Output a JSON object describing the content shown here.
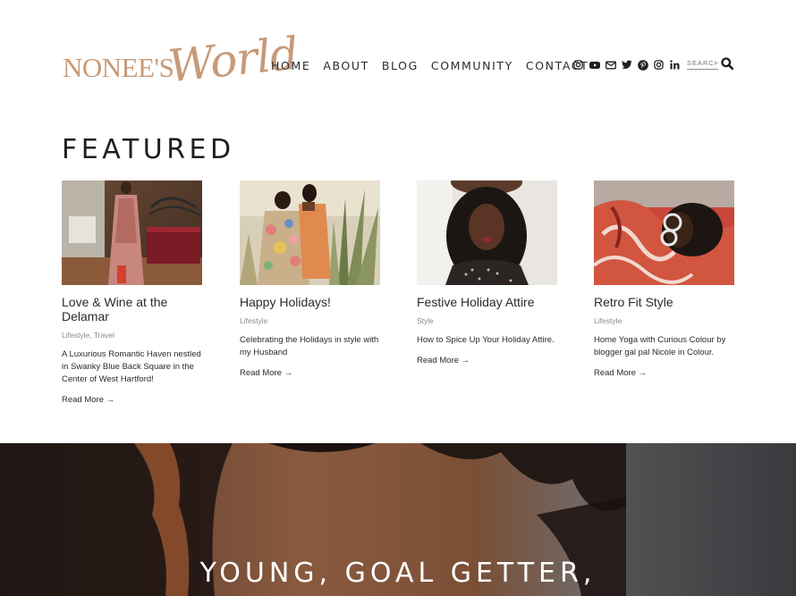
{
  "logo": {
    "main": "NONEE'S",
    "script": "World"
  },
  "nav": [
    "HOME",
    "ABOUT",
    "BLOG",
    "COMMUNITY",
    "CONTACT"
  ],
  "socials": [
    "instagram-icon",
    "youtube-icon",
    "mail-icon",
    "twitter-icon",
    "pinterest-icon",
    "instagram-icon",
    "linkedin-icon"
  ],
  "search": {
    "placeholder": "SEARCH"
  },
  "featured": {
    "heading": "FEATURED",
    "cards": [
      {
        "title": "Love & Wine at the Delamar",
        "category": "Lifestyle, Travel",
        "excerpt": "A Luxurious Romantic Haven nestled in Swanky Blue Back Square in the Center of West Hartford!",
        "more": "Read More →"
      },
      {
        "title": "Happy Holidays!",
        "category": "Lifestyle",
        "excerpt": "Celebrating the Holidays in style with my Husband",
        "more": "Read More →"
      },
      {
        "title": "Festive Holiday Attire",
        "category": "Style",
        "excerpt": "How to Spice Up Your Holiday Attire.",
        "more": "Read More →"
      },
      {
        "title": "Retro Fit Style",
        "category": "Lifestyle",
        "excerpt": "Home Yoga with Curious Colour by blogger gal pal Nicole in Colour.",
        "more": "Read More →"
      }
    ]
  },
  "hero": {
    "text": "YOUNG, GOAL GETTER,"
  },
  "colors": {
    "brand": "#c79a78",
    "text": "#2b2b2b"
  }
}
